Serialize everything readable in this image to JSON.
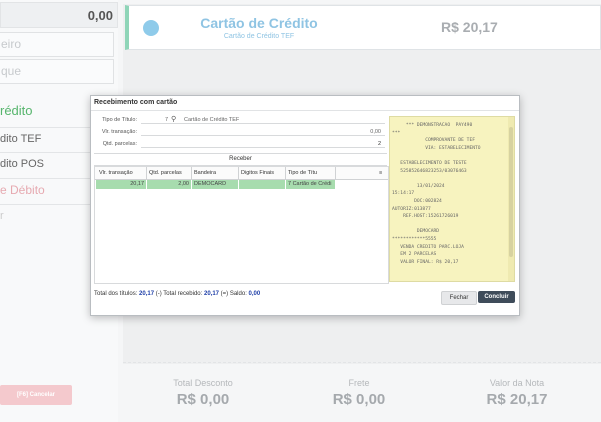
{
  "left_panel": {
    "top_value": "0,00",
    "fields": [
      "eiro",
      "que"
    ],
    "section_label": "rédito",
    "items": [
      "dito TEF",
      "dito POS",
      "e Débito",
      "r"
    ],
    "cancel_button": "[F6] Cancelar"
  },
  "payment_card": {
    "title": "Cartão de Crédito",
    "subtitle": "Cartão de Crédito TEF",
    "amount": "R$ 20,17",
    "accent_color": "#8fd5b8",
    "selected": true
  },
  "totals": [
    {
      "label": "Total Desconto",
      "value": "R$ 0,00"
    },
    {
      "label": "Frete",
      "value": "R$ 0,00"
    },
    {
      "label": "Valor da Nota",
      "value": "R$ 20,17"
    }
  ],
  "modal": {
    "title": "Recebimento com cartão",
    "form": {
      "tipo_titulo_label": "Tipo de Título:",
      "tipo_titulo_code": "7",
      "tipo_titulo_value": "Cartão de Crédito TEF",
      "vlr_transacao_label": "Vlr. transação:",
      "vlr_transacao_value": "0,00",
      "qtd_parcelas_label": "Qtd. parcelas:",
      "qtd_parcelas_value": "2",
      "search_icon": "search-icon"
    },
    "receber_label": "Receber",
    "grid": {
      "columns": [
        "Vlr. transação",
        "Qtd. parcelas",
        "Bandeira",
        "Digitos Finais",
        "Tipo de Títu"
      ],
      "rows": [
        {
          "vlr": "20,17",
          "qtd": "2,00",
          "bandeira": "DEMOCARD",
          "digitos": "",
          "tipo": "7 Cartão de Crédi"
        }
      ],
      "row_highlight_color": "#a7dcae"
    },
    "receipt_lines": [
      "     *** DEMONSTRACAO  PAY490",
      "***",
      "            COMPROVANTE DE TEF",
      "            VIA: ESTABELECIMENTO",
      "",
      "   ESTABELECIMENTO DE TESTE",
      "   525852646823253/03076463",
      "",
      "         13/01/2024",
      "15:14:17",
      "        DOC:002824",
      "AUTORIZ:013877",
      "    REF.HOST:15261726019",
      "",
      "         DEMOCARD",
      "************5555",
      "   VENDA CREDITO PARC.LOJA",
      "   EM 2 PARCELAS",
      "   VALOR FINAL: R$ 20,17"
    ],
    "footer": {
      "total_titulos_label": "Total dos títulos:",
      "total_titulos_value": "20,17",
      "minus": "(-)",
      "total_recebido_label": "Total recebido:",
      "total_recebido_value": "20,17",
      "equals": "(=)",
      "saldo_label": "Saldo:",
      "saldo_value": "0,00"
    },
    "buttons": {
      "fechar": "Fechar",
      "concluir": "Concluir"
    }
  }
}
